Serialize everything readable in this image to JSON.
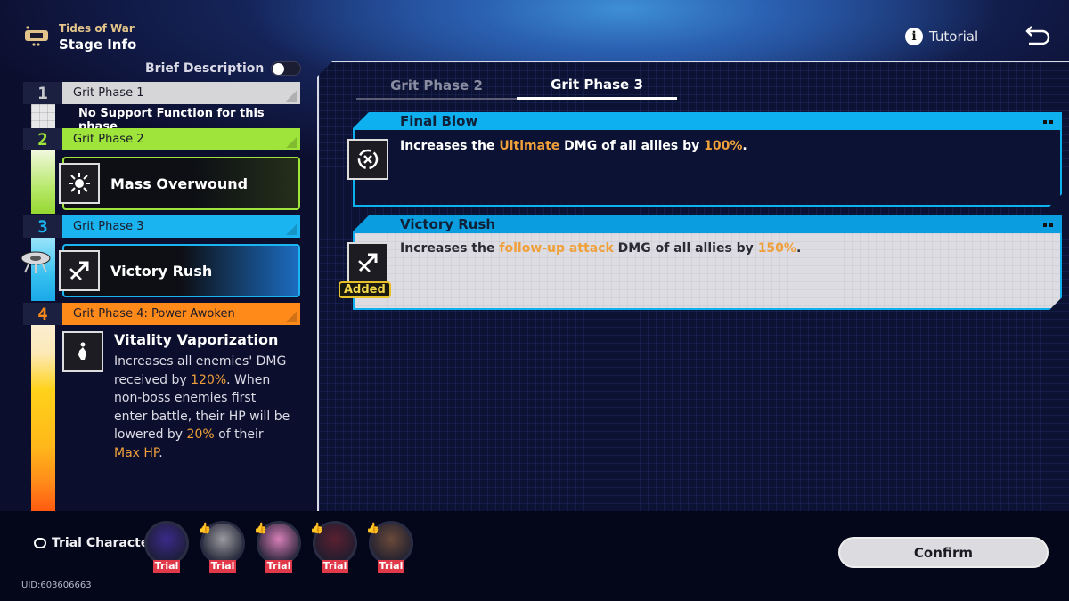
{
  "header": {
    "subtitle": "Tides of War",
    "title": "Stage Info",
    "tutorial_label": "Tutorial",
    "info_icon": "info-icon",
    "back_icon": "back-icon"
  },
  "brief_description": {
    "label": "Brief Description",
    "enabled": false
  },
  "phases": [
    {
      "num": "1",
      "label": "Grit Phase 1",
      "color": "#d6d6d8",
      "num_color": "#c9c9cc",
      "note": "No Support Function for this phase"
    },
    {
      "num": "2",
      "label": "Grit Phase 2",
      "color": "#9ee43a",
      "num_color": "#9ee43a",
      "ability": {
        "name": "Mass Overwound",
        "icon": "burst-icon"
      }
    },
    {
      "num": "3",
      "label": "Grit Phase 3",
      "color": "#1ab4f0",
      "num_color": "#1ab4f0",
      "ability": {
        "name": "Victory Rush",
        "icon": "arrow-swirl-icon"
      }
    },
    {
      "num": "4",
      "label": "Grit Phase 4: Power Awoken",
      "color": "#ff8a1a",
      "num_color": "#ff8a1a",
      "ability": {
        "name": "Vitality Vaporization",
        "icon": "flame-icon",
        "desc_parts": [
          "Increases all enemies' DMG received by ",
          "120%",
          ". When non-boss enemies first enter battle, their HP will be lowered by ",
          "20%",
          " of their ",
          "Max HP",
          "."
        ]
      }
    }
  ],
  "tabs": [
    {
      "label": "Grit Phase 2",
      "active": false
    },
    {
      "label": "Grit Phase 3",
      "active": true
    }
  ],
  "effects": [
    {
      "name": "Final Blow",
      "icon": "target-swirl-icon",
      "style": "dark",
      "text_parts": [
        "Increases the ",
        "Ultimate",
        " DMG of all allies by ",
        "100%",
        "."
      ]
    },
    {
      "name": "Victory Rush",
      "icon": "arrow-swirl-icon",
      "style": "light",
      "badge": "Added",
      "text_parts": [
        "Increases the ",
        "follow-up attack",
        " DMG of all allies by ",
        "150%",
        "."
      ]
    }
  ],
  "trial": {
    "label": "Trial Character",
    "characters": [
      {
        "tag": "Trial",
        "recommended": false,
        "color": "#3a2a8a"
      },
      {
        "tag": "Trial",
        "recommended": true,
        "color": "#9a9aa0"
      },
      {
        "tag": "Trial",
        "recommended": true,
        "color": "#d77fb8"
      },
      {
        "tag": "Trial",
        "recommended": true,
        "color": "#5a2030"
      },
      {
        "tag": "Trial",
        "recommended": true,
        "color": "#6a4a3a"
      }
    ]
  },
  "uid": "UID:603606663",
  "confirm_label": "Confirm",
  "colors": {
    "accent_blue": "#0fb0f0",
    "highlight": "#f0a03a",
    "added_badge": "#e7c12a",
    "trial_tag": "#e0394a"
  }
}
